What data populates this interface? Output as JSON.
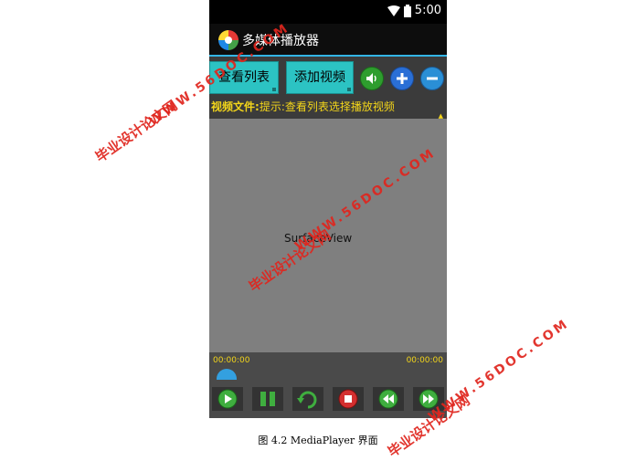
{
  "status": {
    "time": "5:00"
  },
  "app": {
    "title": "多媒体播放器"
  },
  "toolbar": {
    "list_button": "查看列表",
    "add_button": "添加视频",
    "speaker_icon": "speaker-icon",
    "plus_icon": "plus-icon",
    "minus_icon": "minus-icon"
  },
  "hint": {
    "label": "视频文件:",
    "text": "提示:查看列表选择播放视频"
  },
  "surface": {
    "label": "SurfaceView"
  },
  "controls": {
    "time_current": "00:00:00",
    "time_total": "00:00:00",
    "buttons": [
      "play-icon",
      "pause-icon",
      "replay-icon",
      "stop-icon",
      "rewind-icon",
      "forward-icon"
    ]
  },
  "caption": "图 4.2 MediaPlayer 界面",
  "watermark": {
    "url": "WWW.56DOC.COM",
    "cn": "毕业设计论文网"
  },
  "colors": {
    "accent": "#2cc3c3",
    "hint": "#f3d51a",
    "watermark": "#e0261e"
  }
}
